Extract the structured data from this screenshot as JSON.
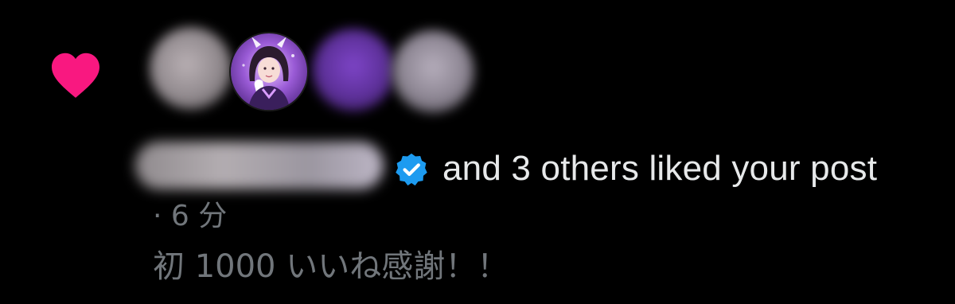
{
  "notification": {
    "type_icon": "heart-icon",
    "heart_color": "#f91880",
    "verified_icon": "verified-badge-icon",
    "verified_color": "#1d9bf0",
    "liked_text": "and 3 others liked your post",
    "time_text": "· 6 分",
    "post_text": "初 1000 いいね感謝！！"
  },
  "colors": {
    "background": "#000000",
    "primary_text": "#e7e9ea",
    "secondary_text": "#71767b"
  }
}
